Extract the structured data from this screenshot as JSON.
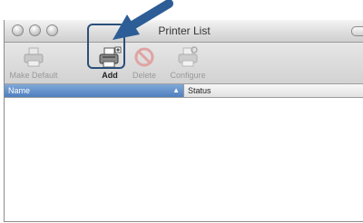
{
  "window": {
    "title": "Printer List"
  },
  "toolbar": {
    "items": [
      {
        "label": "Make Default",
        "icon": "printer-default-icon",
        "enabled": false
      },
      {
        "label": "Add",
        "icon": "printer-add-icon",
        "enabled": true
      },
      {
        "label": "Delete",
        "icon": "delete-icon",
        "enabled": false
      },
      {
        "label": "Configure",
        "icon": "printer-configure-icon",
        "enabled": false
      }
    ]
  },
  "table": {
    "columns": [
      "Name",
      "Status"
    ],
    "sort_indicator": "▲",
    "rows": []
  },
  "colors": {
    "callout_arrow": "#2d5d96",
    "selected_header": "#5f8fcb"
  }
}
